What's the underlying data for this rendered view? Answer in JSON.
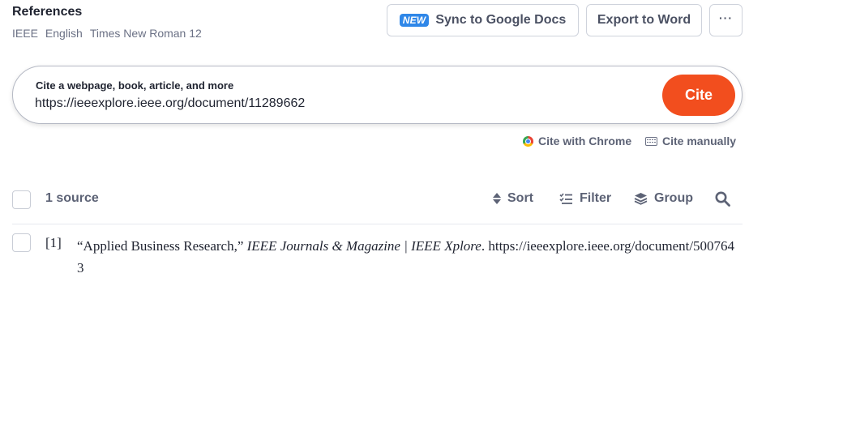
{
  "header": {
    "title": "References",
    "meta": [
      "IEEE",
      "English",
      "Times New Roman 12"
    ],
    "sync_badge": "NEW",
    "sync_label": "Sync to Google Docs",
    "export_label": "Export to Word",
    "more_label": "···"
  },
  "cite": {
    "prompt": "Cite a webpage, book, article, and more",
    "input_value": "https://ieeexplore.ieee.org/document/11289662",
    "button_label": "Cite",
    "chrome_label": "Cite with Chrome",
    "manual_label": "Cite manually"
  },
  "toolbar": {
    "source_count": "1 source",
    "sort_label": "Sort",
    "filter_label": "Filter",
    "group_label": "Group"
  },
  "references": [
    {
      "number": "[1]",
      "title": "“Applied Business Research,”",
      "container": "IEEE Journals & Magazine | IEEE Xplore",
      "url": ". https://ieeexplore.ieee.org/document/5007643"
    }
  ],
  "colors": {
    "accent": "#f24e1e",
    "badge": "#2f87e8",
    "muted_text": "#5c6275"
  }
}
